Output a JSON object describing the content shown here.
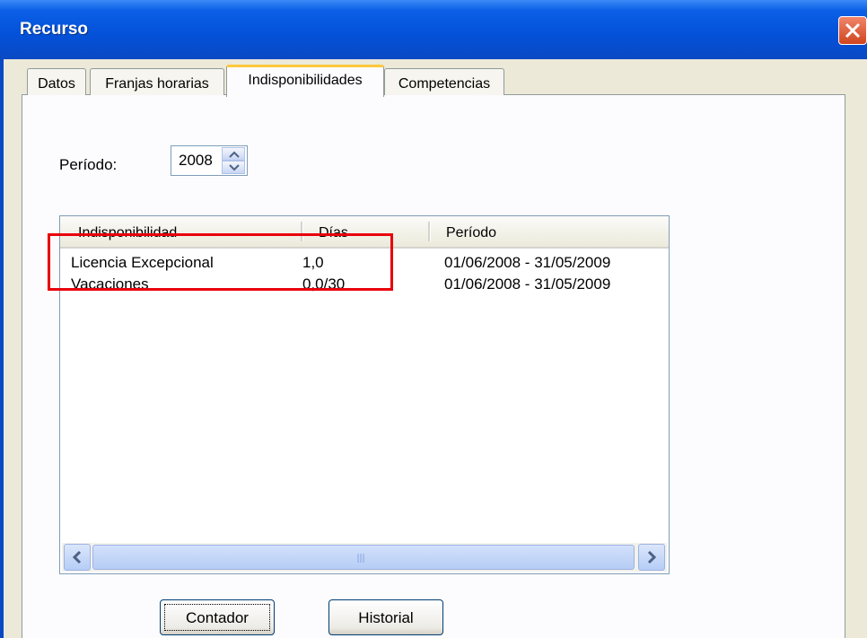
{
  "window": {
    "title": "Recurso"
  },
  "tabs": [
    {
      "label": "Datos"
    },
    {
      "label": "Franjas horarias"
    },
    {
      "label": "Indisponibilidades"
    },
    {
      "label": "Competencias"
    }
  ],
  "periodo": {
    "label": "Período:",
    "value": "2008"
  },
  "table": {
    "columns": [
      "Indisponibilidad",
      "Días",
      "Período"
    ],
    "rows": [
      [
        "Licencia Excepcional",
        "1,0",
        "01/06/2008 - 31/05/2009"
      ],
      [
        "Vacaciones",
        "0,0/30",
        "01/06/2008 - 31/05/2009"
      ]
    ]
  },
  "buttons": {
    "contador": "Contador",
    "historial": "Historial"
  },
  "colors": {
    "titlebar": "#0451d8",
    "active_tab_accent": "#ffc83c",
    "highlight": "#e8000b"
  }
}
